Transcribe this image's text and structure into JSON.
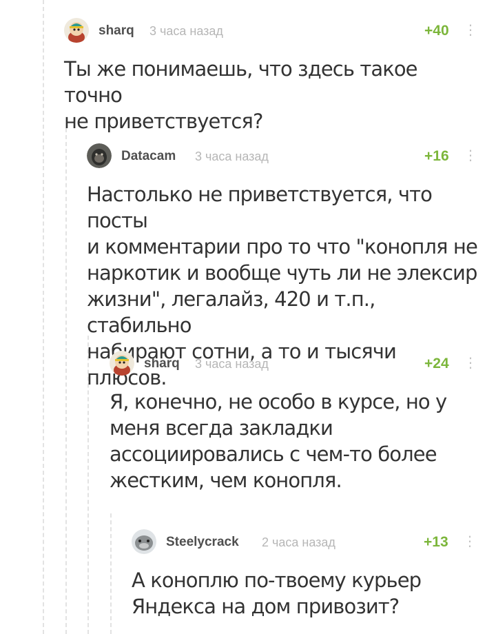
{
  "comments": [
    {
      "username": "sharq",
      "time": "3 часа назад",
      "rating": "+40",
      "avatar": "cartman-avatar",
      "text": "Ты же понимаешь, что здесь такое точно\nне приветствуется?"
    },
    {
      "username": "Datacam",
      "time": "3 часа назад",
      "rating": "+16",
      "avatar": "gorilla-avatar",
      "text": "Настолько не приветствуется, что посты\nи комментарии про то что \"конопля не\nнаркотик и вообще чуть ли не элексир\nжизни\", легалайз, 420 и т.п., стабильно\nнабирают сотни, а то и тысячи плюсов."
    },
    {
      "username": "sharq",
      "time": "3 часа назад",
      "rating": "+24",
      "avatar": "cartman-avatar",
      "text": "Я, конечно, не особо в курсе, но у\nменя всегда закладки\nассоциировались с чем-то более\nжестким, чем конопля."
    },
    {
      "username": "Steelycrack",
      "time": "2 часа назад",
      "rating": "+13",
      "avatar": "seal-avatar",
      "text": "А коноплю по-твоему курьер\nЯндекса на дом привозит?"
    }
  ],
  "colors": {
    "rating": "#7cb63b",
    "username": "#4f4f4f",
    "timestamp": "#b6b6b6",
    "text": "#333333",
    "thread_line": "#e2e2e2"
  }
}
